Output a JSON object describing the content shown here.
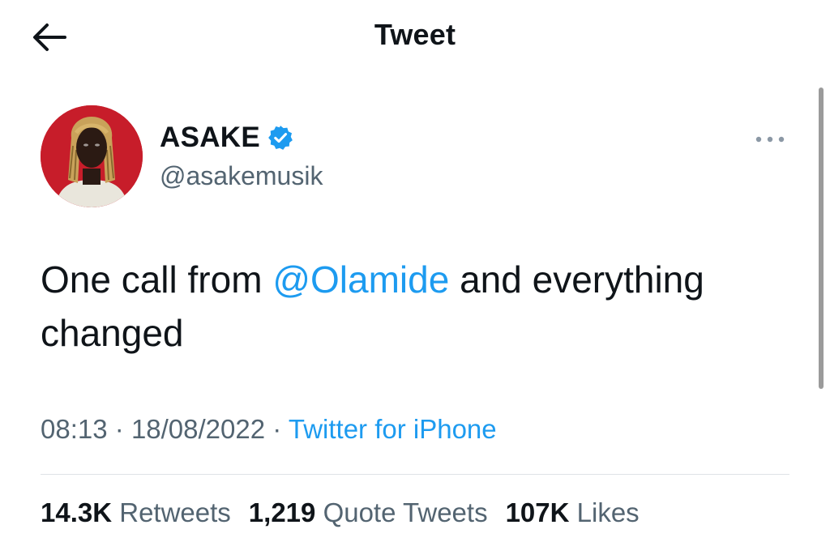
{
  "header": {
    "title": "Tweet",
    "back_icon": "arrow-left-icon"
  },
  "author": {
    "display_name": "ASAKE",
    "verified_icon": "verified-badge-icon",
    "handle": "@asakemusik",
    "avatar": "profile-photo",
    "more_icon": "more-horizontal-icon"
  },
  "tweet": {
    "text_before": "One call from ",
    "mention": "@Olamide",
    "text_after": " and everything changed"
  },
  "meta": {
    "time": "08:13",
    "separator": "·",
    "date": "18/08/2022",
    "source": "Twitter for iPhone"
  },
  "stats": {
    "retweets_count": "14.3K",
    "retweets_label": "Retweets",
    "quotes_count": "1,219",
    "quotes_label": "Quote Tweets",
    "likes_count": "107K",
    "likes_label": "Likes"
  },
  "colors": {
    "accent": "#1d9bf0",
    "secondary_text": "#536471",
    "primary_text": "#0f1419"
  }
}
